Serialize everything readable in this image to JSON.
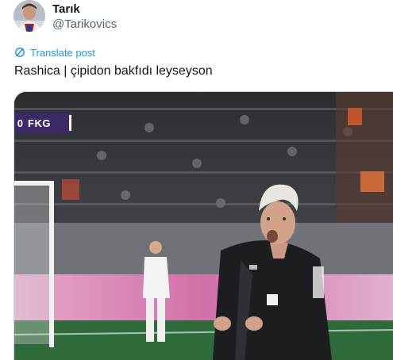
{
  "author": {
    "display_name": "Tarık",
    "handle": "@Tarikovics",
    "avatar_icon": "avatar-photo"
  },
  "translate": {
    "label": "Translate post",
    "icon": "translate-icon",
    "color": "#1d9bf0"
  },
  "post": {
    "text": "Rashica | çipidon bakfıdı leyseyson"
  },
  "media": {
    "scorebug": {
      "score_digit": "0",
      "team": "FKG"
    },
    "colors": {
      "scorebug_bg": "#3a2b67",
      "pitch": "#2f6a3a",
      "ad_board": "#c24a8e"
    }
  }
}
